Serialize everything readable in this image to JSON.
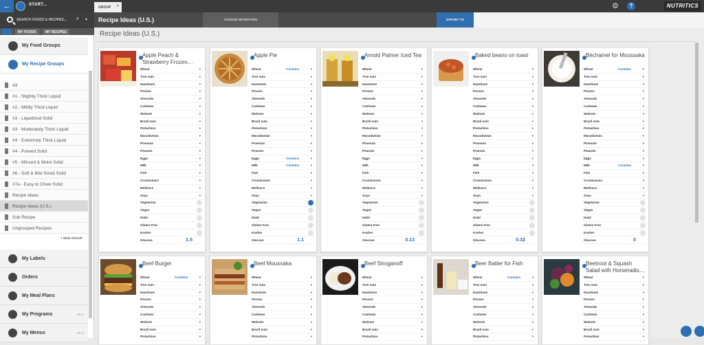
{
  "topbar": {
    "start_label": "START...",
    "tab_label": "GROUP",
    "tab_close": "×",
    "logo": "NUTRITICS",
    "info": "?"
  },
  "search": {
    "placeholder": "SEARCH FOODS & RECIPES...",
    "clear": "x",
    "dropdown": "▾"
  },
  "subtabs": [
    "MY FOODS",
    "MY RECIPES"
  ],
  "sidebar": {
    "food_groups": "My Food Groups",
    "recipe_groups": "My Recipe Groups",
    "items": [
      "All",
      "#1 - Slightly Thick Liquid",
      "#2 - Mildly Thick Liquid",
      "#3 - Liquidized Solid",
      "#3 - Moderately Thick Liquid",
      "#4 - Extremely Thick Liquid",
      "#4 - Pureed Solid",
      "#5 - Minced & Moist Solid",
      "#6 - Soft & Bite Sized Solid",
      "#7a - Easy to Chew Solid",
      "Recipe Ideas",
      "Recipe Ideas (U.S.)",
      "Sub Recipe",
      "Ungrouped Recipes"
    ],
    "new_group": "+ NEW GROUP",
    "bottom": [
      {
        "label": "My Labels",
        "beta": ""
      },
      {
        "label": "Orders",
        "beta": ""
      },
      {
        "label": "My Meal Plans",
        "beta": ""
      },
      {
        "label": "My Programs",
        "beta": "BETA"
      },
      {
        "label": "My Menus",
        "beta": "BETA"
      }
    ]
  },
  "header": {
    "title": "Recipe Ideas (U.S.)",
    "choose": "CHOOSE NUTRITIONS",
    "export": "EXPORT TO"
  },
  "content": {
    "title": "Recipe Ideas (U.S.)"
  },
  "row_labels": [
    "Wheat",
    "Tree nuts",
    "Hazelnuts",
    "Pecans",
    "Almonds",
    "Cashews",
    "Walnuts",
    "Brazil nuts",
    "Pistachios",
    "Macadamias",
    "Pinenuts",
    "Peanuts",
    "Eggs",
    "Milk",
    "Fish",
    "Crustaceans",
    "Molluscs",
    "Soya",
    "Vegetarian",
    "Vegan",
    "Halal",
    "Gluten Free",
    "Kosher",
    "Glucose"
  ],
  "contains_text": "Contains",
  "dropdown_glyph": "▾",
  "cards": [
    {
      "name": "Apple Peach & Strawberry Frozen…",
      "photo": "fruit",
      "contains": [],
      "vegetarian_on": false,
      "glucose": "1.5"
    },
    {
      "name": "Apple Pie",
      "photo": "pie",
      "contains": [
        "Wheat",
        "Eggs",
        "Milk"
      ],
      "vegetarian_on": true,
      "glucose": "1.1"
    },
    {
      "name": "Arnold Palmer Iced Tea",
      "photo": "tea",
      "contains": [],
      "vegetarian_on": false,
      "glucose": "0.13"
    },
    {
      "name": "Baked beans on toast",
      "photo": "beans",
      "contains": [],
      "vegetarian_on": false,
      "glucose": "0.32"
    },
    {
      "name": "Béchamel for Moussaka",
      "photo": "bechamel",
      "contains": [
        "Wheat",
        "Milk"
      ],
      "vegetarian_on": false,
      "glucose": "0"
    },
    {
      "name": "Beef Burger",
      "photo": "burger",
      "contains": [
        "Wheat"
      ],
      "vegetarian_on": false,
      "glucose": ""
    },
    {
      "name": "Beef Moussaka",
      "photo": "moussaka",
      "contains": [],
      "vegetarian_on": false,
      "glucose": ""
    },
    {
      "name": "Beef Stroganoff",
      "photo": "stroganoff",
      "contains": [],
      "vegetarian_on": false,
      "glucose": ""
    },
    {
      "name": "Beer Batter for Fish",
      "photo": "beer",
      "contains": [
        "Wheat"
      ],
      "vegetarian_on": false,
      "glucose": ""
    },
    {
      "name": "Beetroot & Squash Salad with Horseradis…",
      "photo": "salad",
      "contains": [],
      "vegetarian_on": false,
      "glucose": ""
    }
  ]
}
